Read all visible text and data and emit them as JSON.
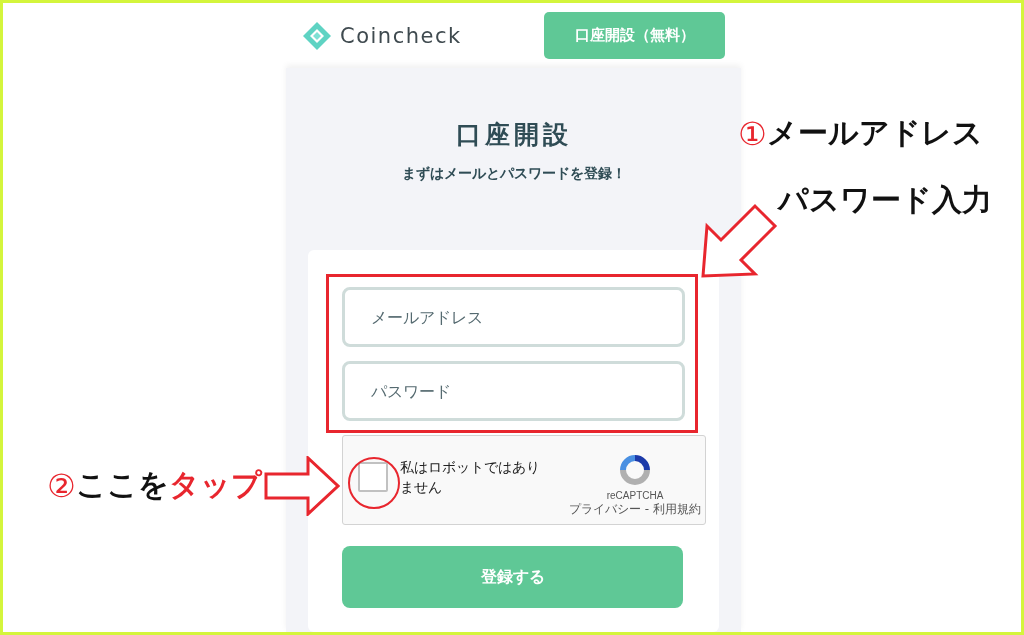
{
  "header": {
    "logo": "Coincheck",
    "signup_button": "口座開設（無料）"
  },
  "form": {
    "title": "口座開設",
    "subtitle": "まずはメールとパスワードを登録！",
    "fields": [
      {
        "placeholder": "メールアドレス"
      },
      {
        "placeholder": "パスワード"
      }
    ],
    "captcha": {
      "label": "私はロボットではありません",
      "checked": false,
      "brand": "reCAPTCHA",
      "links": "プライバシー - 利用規約"
    },
    "submit_button": "登録する"
  },
  "annotations": [
    {
      "marker": "①",
      "lines": [
        "メールアドレス",
        "パスワード入力"
      ]
    },
    {
      "marker": "②",
      "segments": [
        {
          "text": "ここを",
          "color": "#111111"
        },
        {
          "text": "タップ",
          "color": "#e8262e"
        }
      ]
    }
  ]
}
